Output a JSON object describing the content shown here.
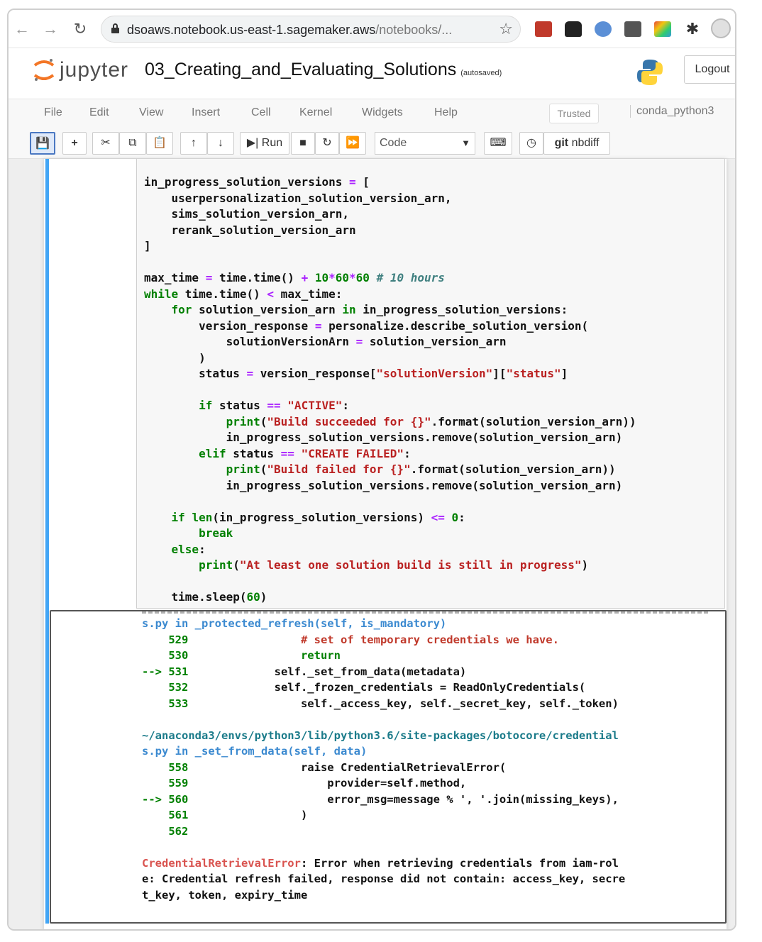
{
  "browser": {
    "url_host": "dsoaws.notebook.us-east-1.sagemaker.aws",
    "url_path": "/notebooks/...",
    "extensions": [
      "ext-red",
      "ext-ghost",
      "ext-shield",
      "ext-camera",
      "ext-color",
      "ext-puzzle",
      "ext-profile"
    ]
  },
  "header": {
    "brand": "jupyter",
    "notebook_title": "03_Creating_and_Evaluating_Solutions",
    "autosave": "(autosaved)",
    "logout_label": "Logout"
  },
  "menubar": {
    "items": [
      "File",
      "Edit",
      "View",
      "Insert",
      "Cell",
      "Kernel",
      "Widgets",
      "Help"
    ],
    "trusted_label": "Trusted",
    "kernel_name": "conda_python3"
  },
  "toolbar": {
    "run_label": "Run",
    "cell_type": "Code",
    "nbdiff_label": "nbdiff"
  },
  "input_code": [
    "in_progress_solution_versions = [",
    "    userpersonalization_solution_version_arn,",
    "    sims_solution_version_arn,",
    "    rerank_solution_version_arn",
    "]",
    "",
    "max_time = time.time() + 10*60*60 # 10 hours",
    "while time.time() < max_time:",
    "    for solution_version_arn in in_progress_solution_versions:",
    "        version_response = personalize.describe_solution_version(",
    "            solutionVersionArn = solution_version_arn",
    "        )",
    "        status = version_response[\"solutionVersion\"][\"status\"]",
    "",
    "        if status == \"ACTIVE\":",
    "            print(\"Build succeeded for {}\".format(solution_version_arn))",
    "            in_progress_solution_versions.remove(solution_version_arn)",
    "        elif status == \"CREATE FAILED\":",
    "            print(\"Build failed for {}\".format(solution_version_arn))",
    "            in_progress_solution_versions.remove(solution_version_arn)",
    "",
    "    if len(in_progress_solution_versions) <= 0:",
    "        break",
    "    else:",
    "        print(\"At least one solution build is still in progress\")",
    "",
    "    time.sleep(60)"
  ],
  "output_traceback": [
    "s.py in _protected_refresh(self, is_mandatory)",
    "    529                 # set of temporary credentials we have.",
    "    530                 return",
    "--> 531             self._set_from_data(metadata)",
    "    532             self._frozen_credentials = ReadOnlyCredentials(",
    "    533                 self._access_key, self._secret_key, self._token)",
    "",
    "~/anaconda3/envs/python3/lib/python3.6/site-packages/botocore/credential",
    "s.py in _set_from_data(self, data)",
    "    558                 raise CredentialRetrievalError(",
    "    559                     provider=self.method,",
    "--> 560                     error_msg=message % ', '.join(missing_keys),",
    "    561                 )",
    "    562",
    "",
    "CredentialRetrievalError: Error when retrieving credentials from iam-rol",
    "e: Credential refresh failed, response did not contain: access_key, secre",
    "t_key, token, expiry_time"
  ],
  "colors": {
    "selected_cell_bar": "#42a5f5",
    "keyword": "#008000",
    "string": "#ba2121",
    "error_name": "#d9534f"
  }
}
